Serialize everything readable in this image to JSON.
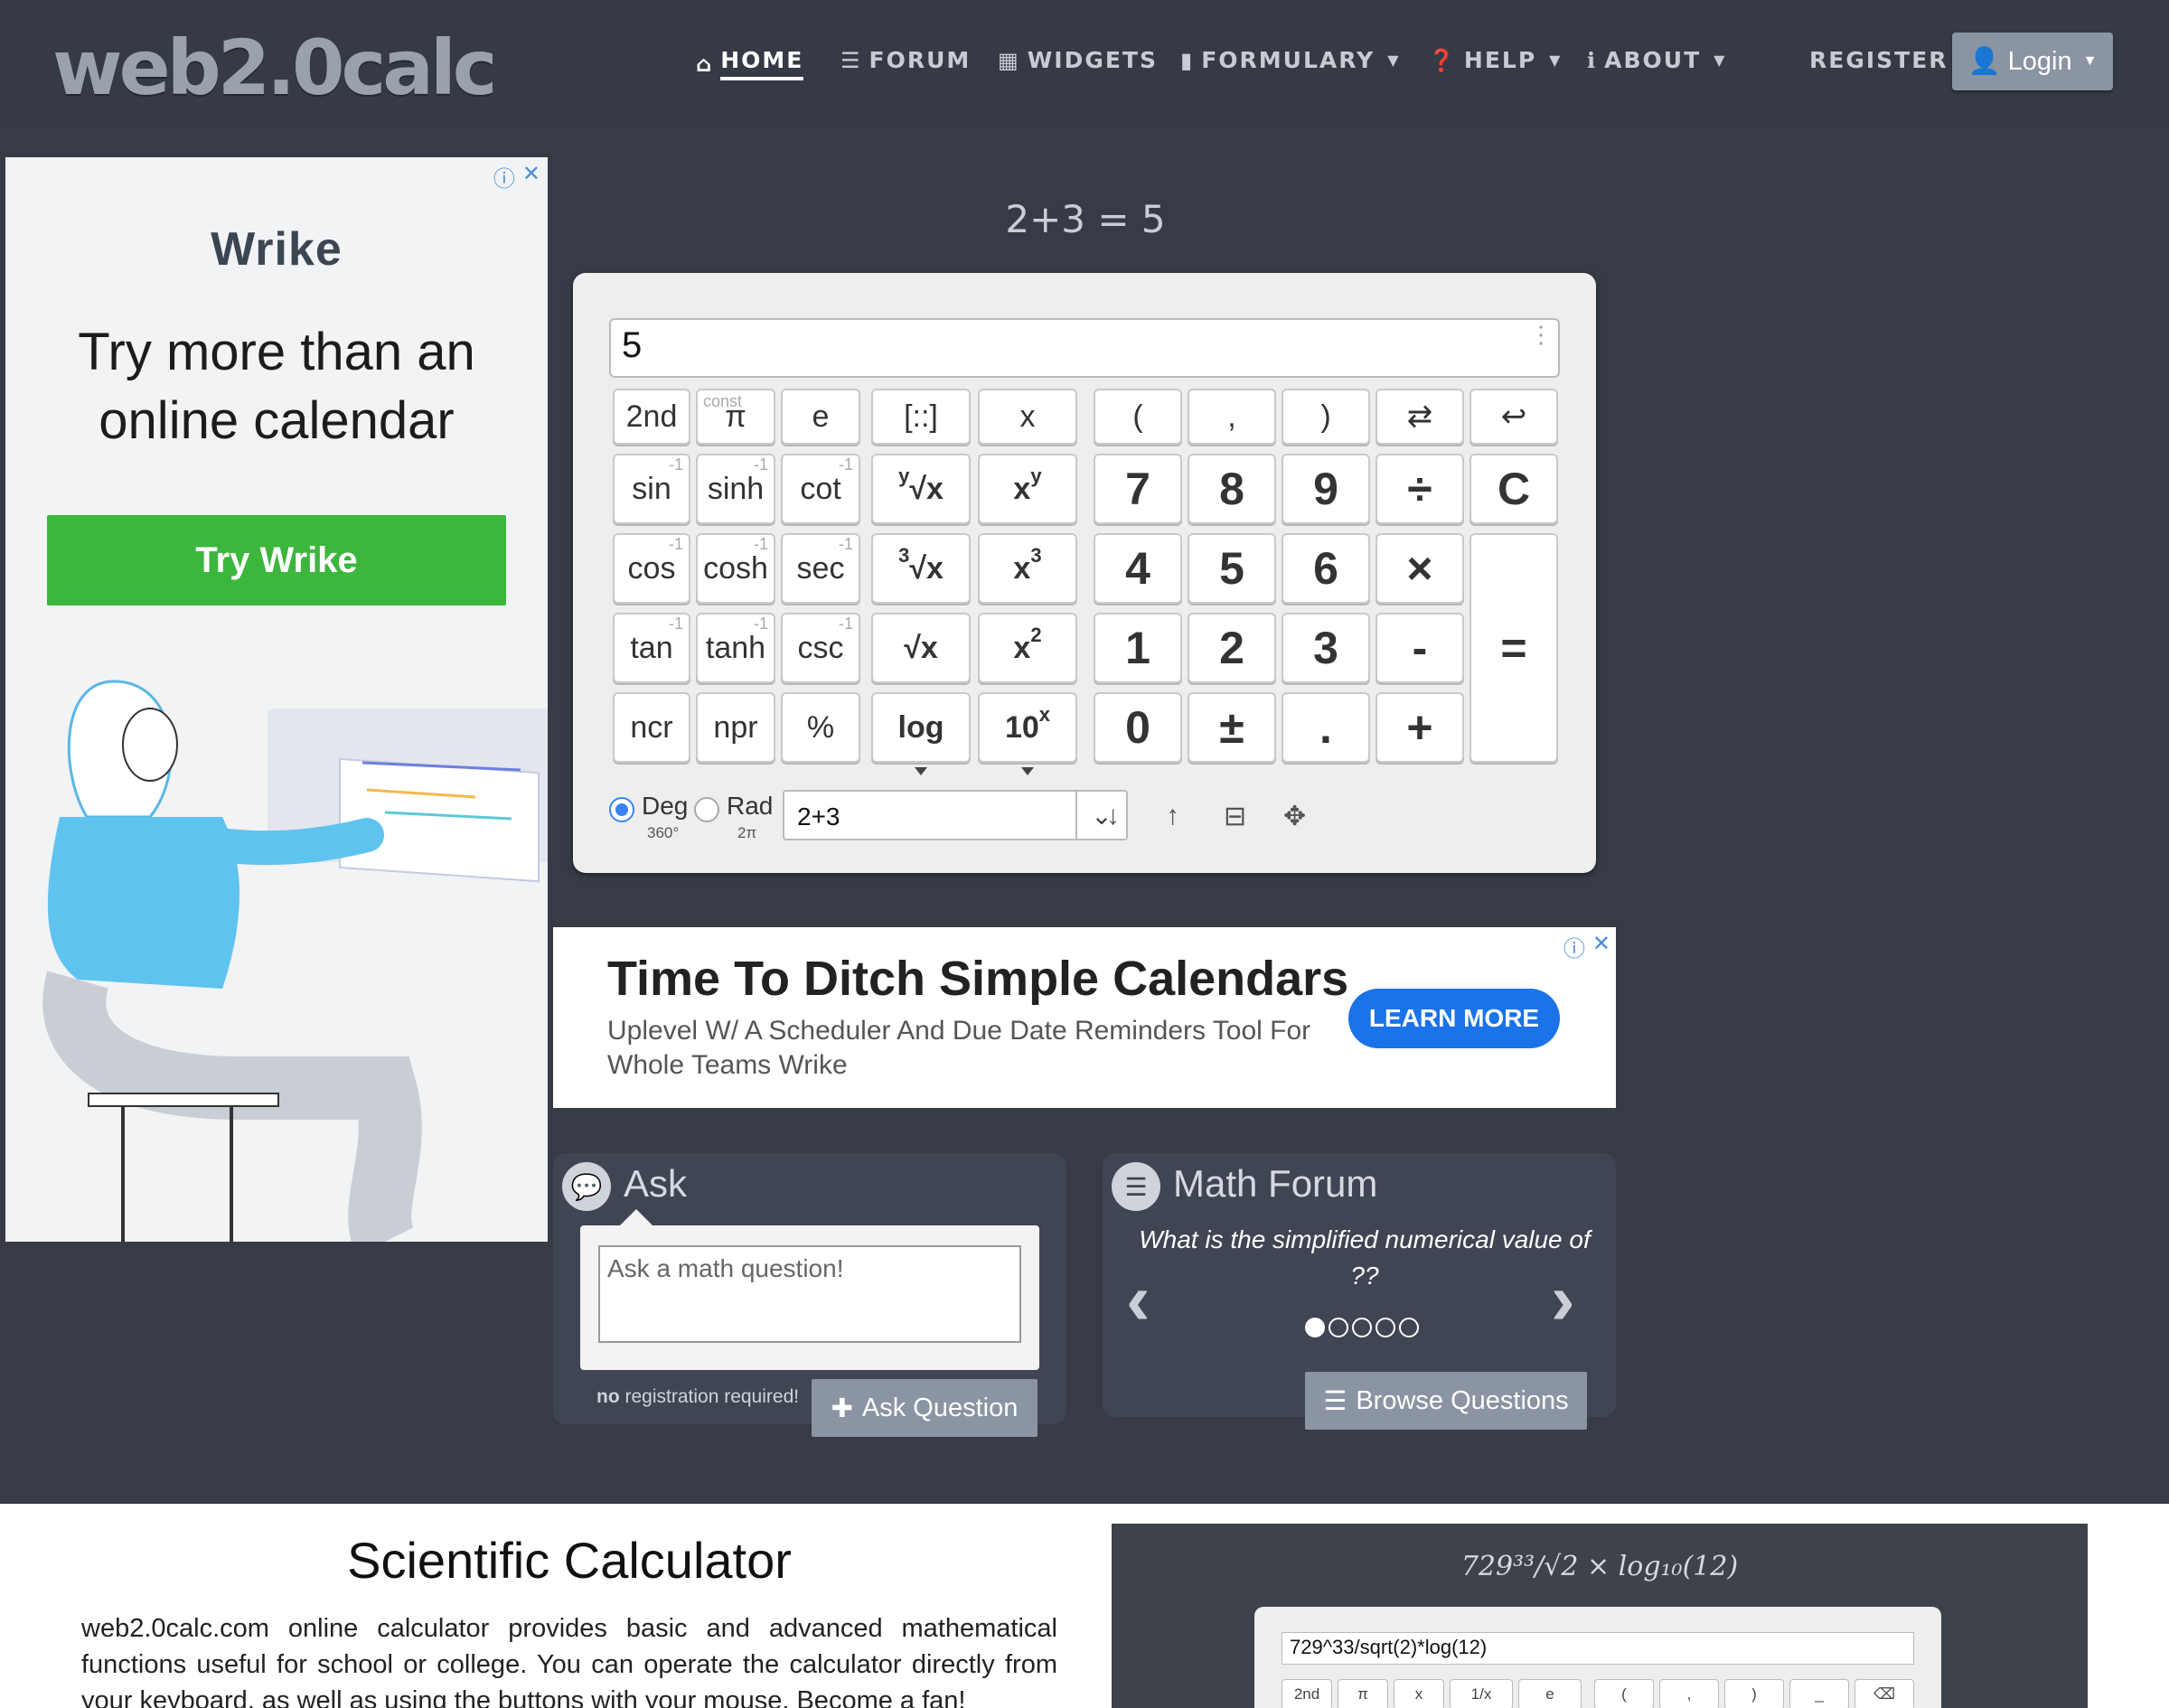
{
  "nav": {
    "logo": "web2.0calc",
    "items": [
      {
        "label": "HOME",
        "icon": "home-icon",
        "glyph": "⌂"
      },
      {
        "label": "FORUM",
        "icon": "list-icon",
        "glyph": "☰"
      },
      {
        "label": "WIDGETS",
        "icon": "calendar-icon",
        "glyph": "▦"
      },
      {
        "label": "FORMULARY",
        "icon": "book-icon",
        "glyph": "▮"
      },
      {
        "label": "HELP",
        "icon": "question-icon",
        "glyph": "❓"
      },
      {
        "label": "ABOUT",
        "icon": "info-icon",
        "glyph": "ℹ"
      }
    ],
    "register": "REGISTER",
    "login": "Login"
  },
  "ad_left": {
    "brand": "Wrike",
    "headline": "Try more than an online calendar",
    "cta": "Try Wrike"
  },
  "calc": {
    "expression_result": "2+3 = 5",
    "display": "5",
    "keys": {
      "row1": [
        "2nd",
        "π",
        "e",
        "[::]",
        "x",
        "(",
        ",",
        ")"
      ],
      "const": "const",
      "row2": [
        "sin",
        "sinh",
        "cot",
        "x",
        "7",
        "8",
        "9",
        "÷",
        "C"
      ],
      "row3": [
        "cos",
        "cosh",
        "sec",
        "x",
        "4",
        "5",
        "6",
        "×"
      ],
      "row4": [
        "tan",
        "tanh",
        "csc",
        "√x",
        "1",
        "2",
        "3",
        "-",
        "="
      ],
      "row5": [
        "ncr",
        "npr",
        "%",
        "log",
        "0",
        "±",
        ".",
        "+"
      ],
      "inv": "-1",
      "root_y": "y",
      "root_3": "3",
      "sup_y": "y",
      "sup_3": "3",
      "sup_2": "2",
      "sup_x": "x",
      "ten": "10"
    },
    "deg_label": "Deg",
    "deg_sub": "360°",
    "rad_label": "Rad",
    "rad_sub": "2π",
    "angle_mode": "Deg",
    "history_value": "2+3"
  },
  "ad_mid": {
    "title": "Time To Ditch Simple Calendars",
    "desc": "Uplevel W/ A Scheduler And Due Date Reminders Tool For Whole Teams Wrike",
    "button": "LEARN MORE"
  },
  "ask": {
    "title": "Ask",
    "placeholder": "Ask a math question!",
    "note_bold": "no",
    "note_rest": " registration required!",
    "button": "Ask Question"
  },
  "forum": {
    "title": "Math Forum",
    "question": "What is the simplified numerical value of ??",
    "active_dot": 1,
    "dot_count": 5,
    "button": "Browse Questions"
  },
  "info": {
    "title": "Scientific Calculator",
    "desc": "web2.0calc.com online calculator provides basic and advanced mathematical functions useful for school or college. You can operate the calculator directly from your keyboard, as well as using the buttons with your mouse. Become a fan!"
  },
  "preview": {
    "expression": "729³³/√2 × log₁₀(12)",
    "input": "729^33/sqrt(2)*log(12)",
    "keys": [
      "2nd",
      "π",
      "x",
      "1/x",
      "e",
      "(",
      ",",
      ")",
      "_",
      "⌫"
    ]
  }
}
